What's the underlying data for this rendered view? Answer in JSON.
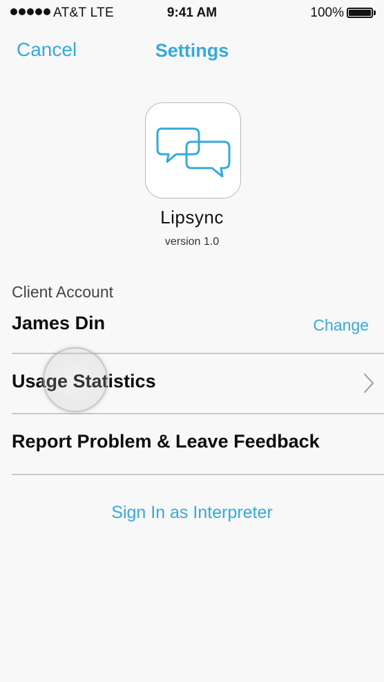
{
  "status_bar": {
    "carrier": "AT&T  LTE",
    "time": "9:41 AM",
    "battery_percent": "100%",
    "signal_icon": "signal-dots-icon",
    "battery_icon": "battery-full-icon"
  },
  "nav": {
    "cancel_label": "Cancel",
    "title": "Settings"
  },
  "app": {
    "name": "Lipsync",
    "version": "version 1.0",
    "icon": "chat-bubbles-icon"
  },
  "account": {
    "section_label": "Client Account",
    "name": "James Din",
    "change_label": "Change"
  },
  "rows": {
    "usage_label": "Usage Statistics",
    "report_label": "Report Problem & Leave Feedback"
  },
  "interpreter_link": "Sign In as Interpreter",
  "colors": {
    "accent": "#34aadc",
    "background": "#f8f8f8",
    "divider": "#c8c8c8"
  }
}
